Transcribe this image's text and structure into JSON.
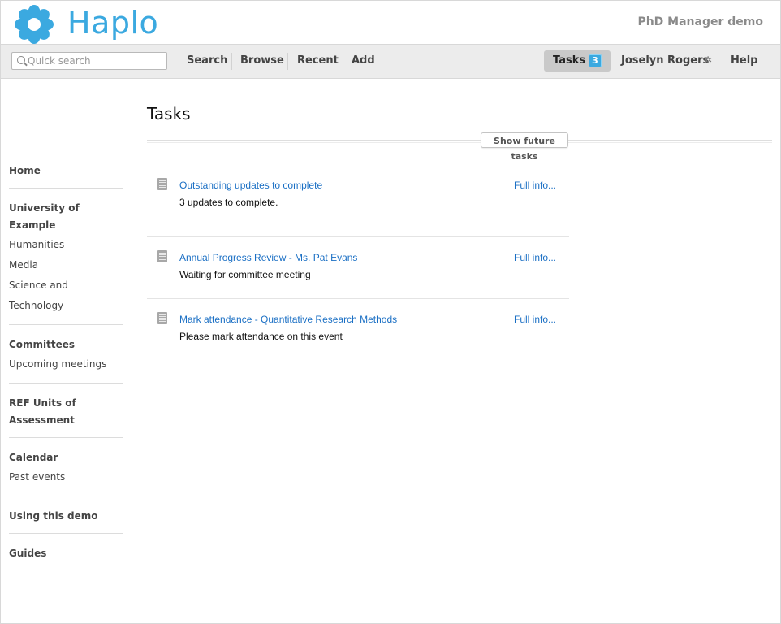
{
  "header": {
    "brand": "Haplo",
    "site_name": "PhD Manager demo",
    "logo_icon": "flower-logo-icon",
    "brand_color": "#3ba9e0"
  },
  "toolbar": {
    "search_placeholder": "Quick search",
    "search_value": "",
    "nav": [
      "Search",
      "Browse",
      "Recent",
      "Add"
    ],
    "tasks_label": "Tasks",
    "tasks_count": "3",
    "user_name": "Joselyn Rogers",
    "user_icon": "gear-icon",
    "help_label": "Help"
  },
  "sidebar": {
    "groups": [
      {
        "heading": "Home",
        "links": []
      },
      {
        "heading": "University of Example",
        "links": [
          "Humanities",
          "Media",
          "Science and Technology"
        ]
      },
      {
        "heading": "Committees",
        "links": [
          "Upcoming meetings"
        ]
      },
      {
        "heading": "REF Units of Assessment",
        "links": []
      },
      {
        "heading": "Calendar",
        "links": [
          "Past events"
        ]
      },
      {
        "heading": "Using this demo",
        "links": []
      },
      {
        "heading": "Guides",
        "links": []
      }
    ]
  },
  "main": {
    "title": "Tasks",
    "future_button": "Show future tasks",
    "tasks": [
      {
        "title": "Outstanding updates to complete",
        "desc": "3 updates to complete.",
        "info": "Full info..."
      },
      {
        "title": "Annual Progress Review - Ms. Pat Evans",
        "desc": "Waiting for committee meeting",
        "info": "Full info..."
      },
      {
        "title": "Mark attendance - Quantitative Research Methods",
        "desc": "Please mark attendance on this event",
        "info": "Full info..."
      }
    ]
  },
  "colors": {
    "link": "#1a6fc4",
    "badge": "#3ba9e0",
    "toolbar_bg": "#ececec"
  }
}
